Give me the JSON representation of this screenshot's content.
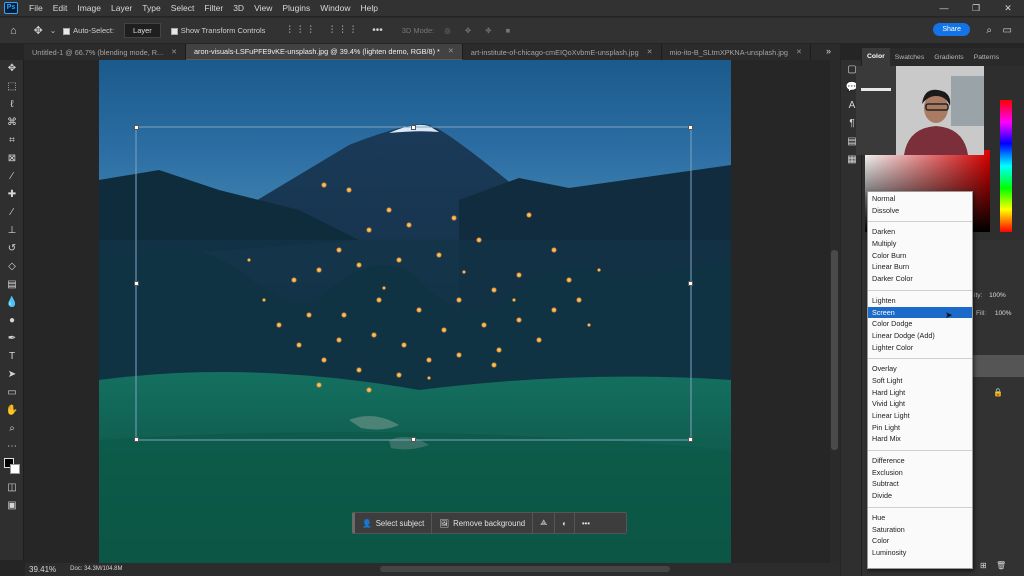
{
  "app": {
    "logo": "Ps"
  },
  "menu": [
    "File",
    "Edit",
    "Image",
    "Layer",
    "Type",
    "Select",
    "Filter",
    "3D",
    "View",
    "Plugins",
    "Window",
    "Help"
  ],
  "window_controls": [
    "—",
    "❐",
    "✕"
  ],
  "options": {
    "auto_select_label": "Auto-Select:",
    "auto_select_value": "Layer",
    "transform_label": "Show Transform Controls",
    "mode_label": "3D Mode:",
    "share_label": "Share"
  },
  "tabs": [
    {
      "label": "Untitled-1 @ 66.7% (blending mode, R...",
      "active": false
    },
    {
      "label": "aron-visuals-LSFuPFE9vKE-unsplash.jpg @ 39.4% (lighten demo, RGB/8) *",
      "active": true
    },
    {
      "label": "art-institute-of-chicago-cmEIQoXvbmE-unsplash.jpg",
      "active": false
    },
    {
      "label": "mio-ito-B_SLtmXPKNA-unsplash.jpg",
      "active": false
    }
  ],
  "status": {
    "zoom": "39.41%",
    "doc": "Doc: 34.3M/104.8M"
  },
  "contextual_bar": {
    "select_subject": "Select subject",
    "remove_background": "Remove background",
    "more": "•••"
  },
  "panel_tabs": [
    "Color",
    "Swatches",
    "Gradients",
    "Patterns"
  ],
  "layers_panel": {
    "opacity_label": "ity:",
    "opacity_value": "100%",
    "fill_label": "Fill:",
    "fill_value": "100%"
  },
  "blend_modes": [
    [
      "Normal",
      "Dissolve"
    ],
    [
      "Darken",
      "Multiply",
      "Color Burn",
      "Linear Burn",
      "Darker Color"
    ],
    [
      "Lighten",
      "Screen",
      "Color Dodge",
      "Linear Dodge (Add)",
      "Lighter Color"
    ],
    [
      "Overlay",
      "Soft Light",
      "Hard Light",
      "Vivid Light",
      "Linear Light",
      "Pin Light",
      "Hard Mix"
    ],
    [
      "Difference",
      "Exclusion",
      "Subtract",
      "Divide"
    ],
    [
      "Hue",
      "Saturation",
      "Color",
      "Luminosity"
    ]
  ],
  "selected_blend_mode": "Screen",
  "colors": {
    "accent": "#1473e6",
    "selection": "#1b6ac9",
    "firefly": "#f5a53a"
  },
  "icons": [
    "home-icon",
    "move-icon",
    "marquee-icon",
    "lasso-icon",
    "object-select-icon",
    "crop-icon",
    "frame-icon",
    "eyedropper-icon",
    "healing-icon",
    "brush-icon",
    "stamp-icon",
    "history-brush-icon",
    "eraser-icon",
    "gradient-icon",
    "blur-icon",
    "dodge-icon",
    "pen-icon",
    "type-icon",
    "path-select-icon",
    "rectangle-icon",
    "hand-icon",
    "zoom-icon",
    "more-tools-icon",
    "search-icon",
    "workspace-icon"
  ]
}
